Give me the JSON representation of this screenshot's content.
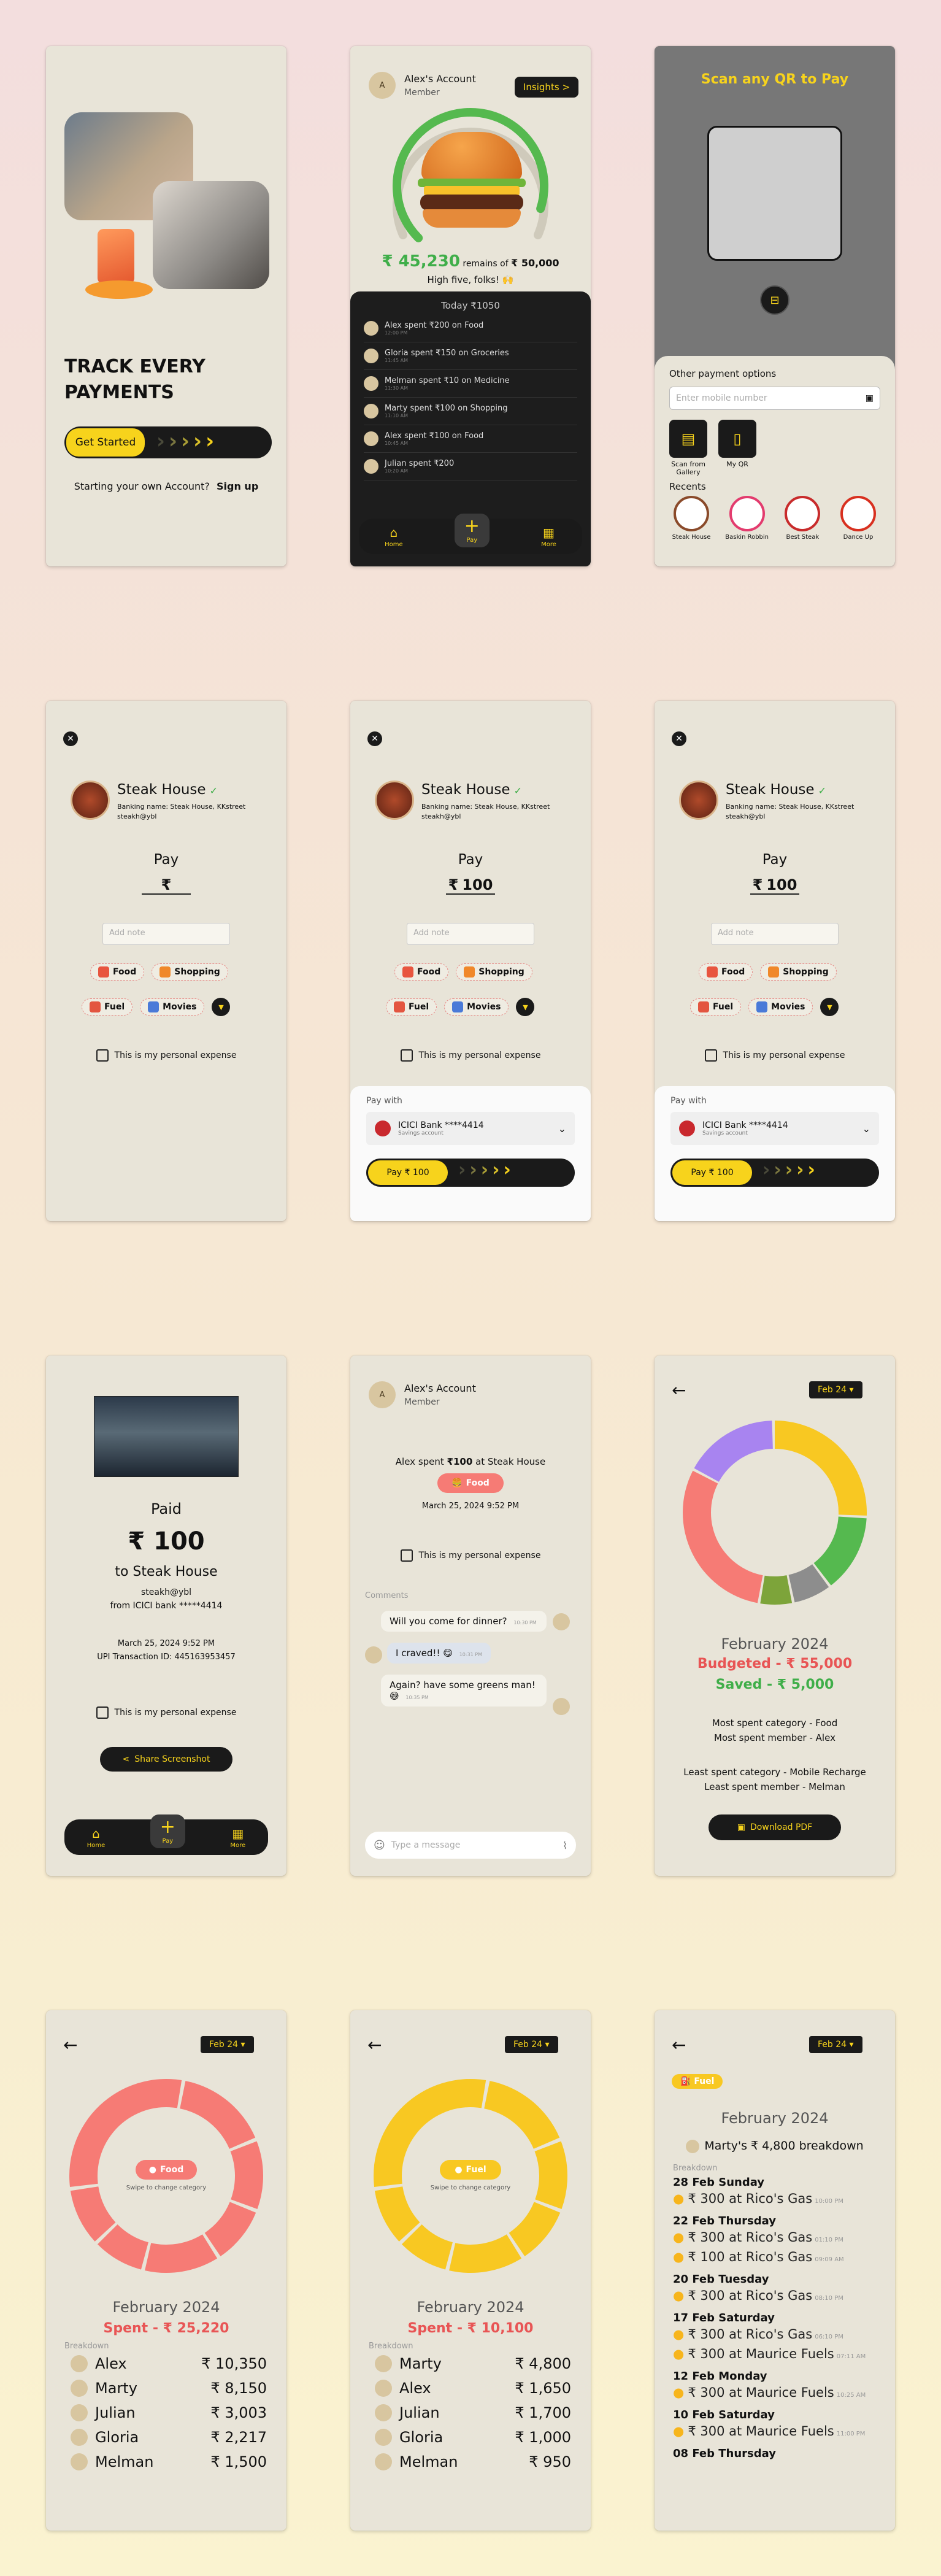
{
  "onboarding": {
    "headline": "TRACK EVERY PAYMENTS",
    "cta": "Get Started",
    "signup_prompt": "Starting your own Account?",
    "signup_link": "Sign up"
  },
  "home": {
    "account_name": "Alex's Account",
    "account_role": "Member",
    "insights": "Insights >",
    "remaining_amount": "₹ 45,230",
    "remains_of": "remains of",
    "budget_total": "₹ 50,000",
    "cheer": "High five, folks! 🙌",
    "budget_progress": 0.9,
    "today_label": "Today ₹1050",
    "feed": [
      {
        "text": "Alex spent ₹200 on Food",
        "time": "12:00 PM"
      },
      {
        "text": "Gloria spent ₹150 on Groceries",
        "time": "11:45 AM"
      },
      {
        "text": "Melman spent ₹10 on Medicine",
        "time": "11:30 AM"
      },
      {
        "text": "Marty spent ₹100 on Shopping",
        "time": "11:10 AM"
      },
      {
        "text": "Alex spent ₹100 on Food",
        "time": "10:45 AM"
      },
      {
        "text": "Julian spent ₹200",
        "time": "10:20 AM"
      }
    ],
    "nav": {
      "home": "Home",
      "pay": "Pay",
      "more": "More"
    }
  },
  "scan": {
    "title": "Scan any QR to Pay",
    "other_options": "Other payment options",
    "mobile_placeholder": "Enter mobile number",
    "gallery": "Scan from Gallery",
    "my_qr": "My QR",
    "recents_label": "Recents",
    "recents": [
      "Steak House",
      "Baskin Robbin",
      "Best Steak",
      "Dance Up"
    ]
  },
  "pay": {
    "merchant": "Steak House",
    "banking_name": "Banking name: Steak House, KKstreet",
    "handle": "steakh@ybl",
    "pay_label": "Pay",
    "currency": "₹",
    "amount": "100",
    "note_placeholder": "Add note",
    "categories": [
      "Food",
      "Shopping",
      "Fuel",
      "Movies"
    ],
    "personal_expense": "This is my personal expense",
    "pay_with": "Pay with",
    "bank": "ICICI Bank ****4414",
    "account_type": "Savings account",
    "pay_button": "Pay ₹ 100"
  },
  "receipt": {
    "status": "Paid",
    "amount": "₹ 100",
    "to": "to Steak House",
    "handle": "steakh@ybl",
    "from": "from ICICI bank *****4414",
    "datetime": "March 25, 2024 9:52 PM",
    "upi": "UPI Transaction ID: 445163953457",
    "personal_expense": "This is my personal expense",
    "share": "Share Screenshot"
  },
  "chat": {
    "account_name": "Alex's Account",
    "account_role": "Member",
    "summary_prefix": "Alex spent ",
    "summary_amount": "₹100",
    "summary_suffix": " at Steak House",
    "category": "Food",
    "datetime": "March 25, 2024 9:52 PM",
    "personal_expense": "This is my personal expense",
    "comments_label": "Comments",
    "messages": [
      {
        "text": "Will you come for dinner?",
        "time": "10:30 PM"
      },
      {
        "text": "I craved!! 😋",
        "time": "10:31 PM"
      },
      {
        "text": "Again? have some greens man! 😅",
        "time": "10:35 PM"
      }
    ],
    "input_placeholder": "Type a message"
  },
  "overview": {
    "month_chip": "Feb 24 ▾",
    "month": "February 2024",
    "budgeted": "Budgeted - ₹ 55,000",
    "saved": "Saved - ₹ 5,000",
    "most_category": "Most spent category - Food",
    "most_member": "Most spent member - Alex",
    "least_category": "Least spent category - Mobile Recharge",
    "least_member": "Least spent member - Melman",
    "download": "Download PDF"
  },
  "food_breakdown": {
    "month_chip": "Feb 24 ▾",
    "center_label": "Food",
    "swipe_hint": "Swipe to change category",
    "month": "February 2024",
    "spent": "Spent - ₹ 25,220",
    "breakdown_label": "Breakdown",
    "rows": [
      {
        "name": "Alex",
        "amount": "₹ 10,350"
      },
      {
        "name": "Marty",
        "amount": "₹ 8,150"
      },
      {
        "name": "Julian",
        "amount": "₹ 3,003"
      },
      {
        "name": "Gloria",
        "amount": "₹ 2,217"
      },
      {
        "name": "Melman",
        "amount": "₹ 1,500"
      }
    ]
  },
  "fuel_breakdown": {
    "month_chip": "Feb 24 ▾",
    "center_label": "Fuel",
    "swipe_hint": "Swipe to change category",
    "month": "February 2024",
    "spent": "Spent - ₹ 10,100",
    "breakdown_label": "Breakdown",
    "rows": [
      {
        "name": "Marty",
        "amount": "₹ 4,800"
      },
      {
        "name": "Alex",
        "amount": "₹ 1,650"
      },
      {
        "name": "Julian",
        "amount": "₹ 1,700"
      },
      {
        "name": "Gloria",
        "amount": "₹ 1,000"
      },
      {
        "name": "Melman",
        "amount": "₹ 950"
      }
    ]
  },
  "member_detail": {
    "month_chip": "Feb 24 ▾",
    "category": "Fuel",
    "month": "February 2024",
    "title": "Marty's ₹ 4,800 breakdown",
    "breakdown_label": "Breakdown",
    "days": [
      {
        "date": "28 Feb Sunday",
        "items": [
          {
            "text": "₹ 300 at Rico's Gas",
            "time": "10:00 PM"
          }
        ]
      },
      {
        "date": "22 Feb Thursday",
        "items": [
          {
            "text": "₹ 300 at Rico's Gas",
            "time": "01:10 PM"
          },
          {
            "text": "₹ 100 at Rico's Gas",
            "time": "09:09 AM"
          }
        ]
      },
      {
        "date": "20 Feb Tuesday",
        "items": [
          {
            "text": "₹ 300 at Rico's Gas",
            "time": "08:10 PM"
          }
        ]
      },
      {
        "date": "17 Feb Saturday",
        "items": [
          {
            "text": "₹ 300 at Rico's Gas",
            "time": "06:10 PM"
          },
          {
            "text": "₹ 300 at Maurice Fuels",
            "time": "07:11 AM"
          }
        ]
      },
      {
        "date": "12 Feb Monday",
        "items": [
          {
            "text": "₹ 300 at Maurice Fuels",
            "time": "10:25 AM"
          }
        ]
      },
      {
        "date": "10 Feb Saturday",
        "items": [
          {
            "text": "₹ 300 at Maurice Fuels",
            "time": "11:00 PM"
          }
        ]
      },
      {
        "date": "08 Feb Thursday",
        "items": []
      }
    ]
  },
  "colors": {
    "accent": "#f7d31c",
    "food": "#f67b75",
    "saved": "#3fae49",
    "budgeted": "#e85555"
  }
}
